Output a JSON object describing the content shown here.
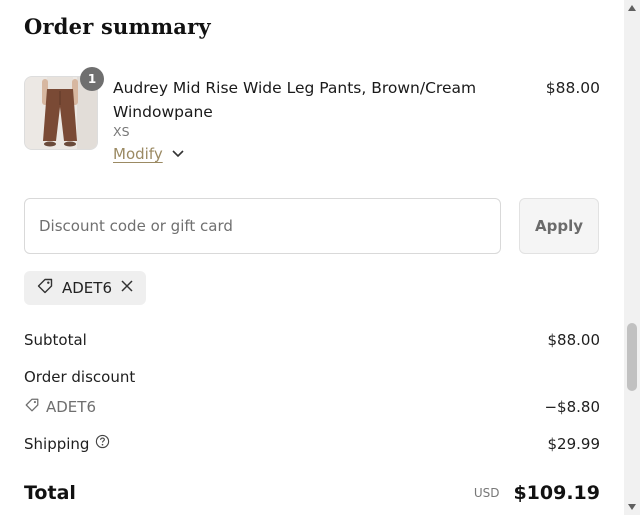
{
  "title": "Order summary",
  "product": {
    "quantity": "1",
    "name": "Audrey Mid Rise Wide Leg Pants, Brown/Cream Windowpane",
    "variant": "XS",
    "modify_label": "Modify",
    "price": "$88.00"
  },
  "discount": {
    "placeholder": "Discount code or gift card",
    "value": "",
    "apply_label": "Apply",
    "applied_code": "ADET6"
  },
  "summary": {
    "subtotal_label": "Subtotal",
    "subtotal_value": "$88.00",
    "order_discount_label": "Order discount",
    "discount_code": "ADET6",
    "discount_value": "−$8.80",
    "shipping_label": "Shipping",
    "shipping_value": "$29.99",
    "total_label": "Total",
    "currency": "USD",
    "total_value": "$109.19"
  },
  "colors": {
    "link": "#9b8a63",
    "badge": "#6f6f6f",
    "chip_bg": "#efefef",
    "product_brown": "#7a4a35"
  },
  "icons": [
    "tag-icon",
    "close-icon",
    "chevron-down-icon",
    "help-icon"
  ]
}
